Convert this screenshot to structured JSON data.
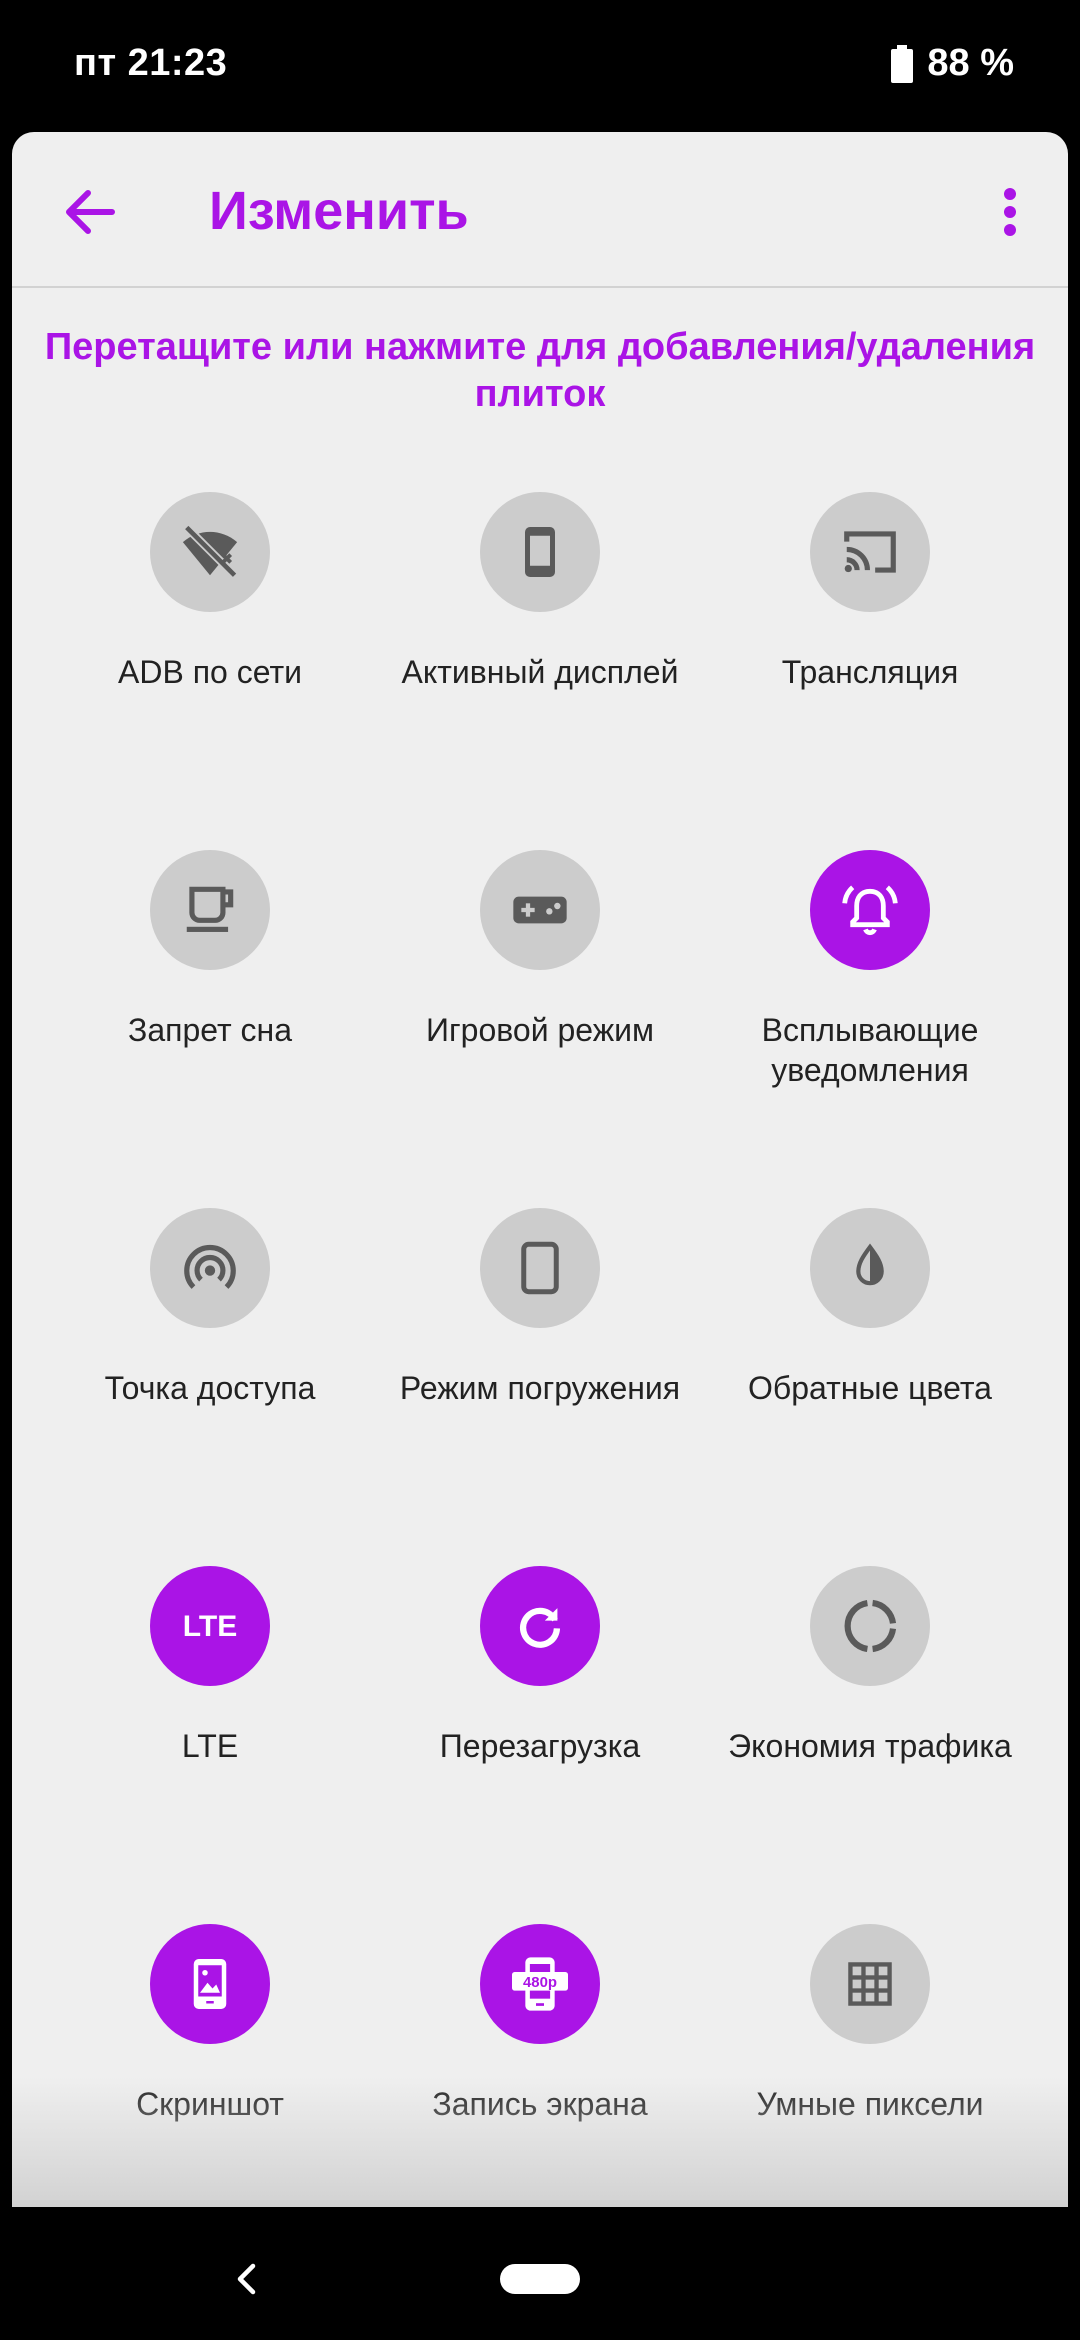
{
  "status_bar": {
    "time": "пт 21:23",
    "battery": "88 %"
  },
  "toolbar": {
    "title": "Изменить",
    "back_icon": "arrow-back-icon",
    "more_icon": "more-vert-icon"
  },
  "instruction": "Перетащите или нажмите для добавления/удаления плиток",
  "colors": {
    "accent": "#aa14e6",
    "tile_inactive": "#cccccc",
    "icon_inactive": "#5a5a5a"
  },
  "tiles": [
    {
      "label": "ADB по сети",
      "icon": "wifi-off-icon",
      "active": false
    },
    {
      "label": "Активный дисплей",
      "icon": "phone-display-icon",
      "active": false
    },
    {
      "label": "Трансляция",
      "icon": "cast-icon",
      "active": false
    },
    {
      "label": "Запрет сна",
      "icon": "coffee-cup-icon",
      "active": false
    },
    {
      "label": "Игровой режим",
      "icon": "gamepad-icon",
      "active": false
    },
    {
      "label": "Всплывающие уведомления",
      "icon": "alarm-bell-icon",
      "active": true
    },
    {
      "label": "Точка доступа",
      "icon": "hotspot-icon",
      "active": false
    },
    {
      "label": "Режим погружения",
      "icon": "fullscreen-tablet-icon",
      "active": false
    },
    {
      "label": "Обратные цвета",
      "icon": "invert-colors-icon",
      "active": false
    },
    {
      "label": "LTE",
      "icon": "lte-icon",
      "active": true
    },
    {
      "label": "Перезагрузка",
      "icon": "restart-icon",
      "active": true
    },
    {
      "label": "Экономия трафика",
      "icon": "data-saver-icon",
      "active": false
    },
    {
      "label": "Скриншот",
      "icon": "screenshot-icon",
      "active": true
    },
    {
      "label": "Запись экрана",
      "icon": "screen-record-icon",
      "active": true,
      "badge": "480p"
    },
    {
      "label": "Умные пиксели",
      "icon": "grid-pixels-icon",
      "active": false
    }
  ]
}
